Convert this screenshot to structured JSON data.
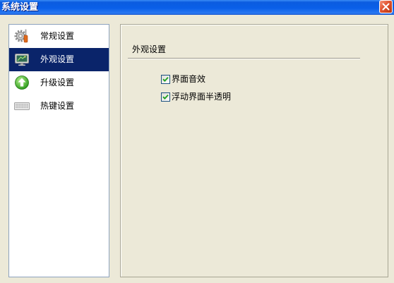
{
  "window": {
    "title": "系统设置"
  },
  "sidebar": {
    "items": [
      {
        "label": "常规设置",
        "icon": "tools-gear-icon",
        "selected": false
      },
      {
        "label": "外观设置",
        "icon": "monitor-icon",
        "selected": true
      },
      {
        "label": "升级设置",
        "icon": "upgrade-arrow-icon",
        "selected": false
      },
      {
        "label": "热键设置",
        "icon": "keyboard-icon",
        "selected": false
      }
    ]
  },
  "panel": {
    "group_title": "外观设置",
    "options": [
      {
        "label": "界面音效",
        "checked": true
      },
      {
        "label": "浮动界面半透明",
        "checked": true
      }
    ]
  },
  "icons": {
    "close": "close-icon",
    "check": "checkmark-icon"
  },
  "colors": {
    "dialog_bg": "#ECE9D8",
    "title_bar": "#0A5FE8",
    "selection_bg": "#0A246A",
    "selection_text": "#FFFFFF",
    "check_mark": "#21A121",
    "close_button": "#E0532F"
  }
}
